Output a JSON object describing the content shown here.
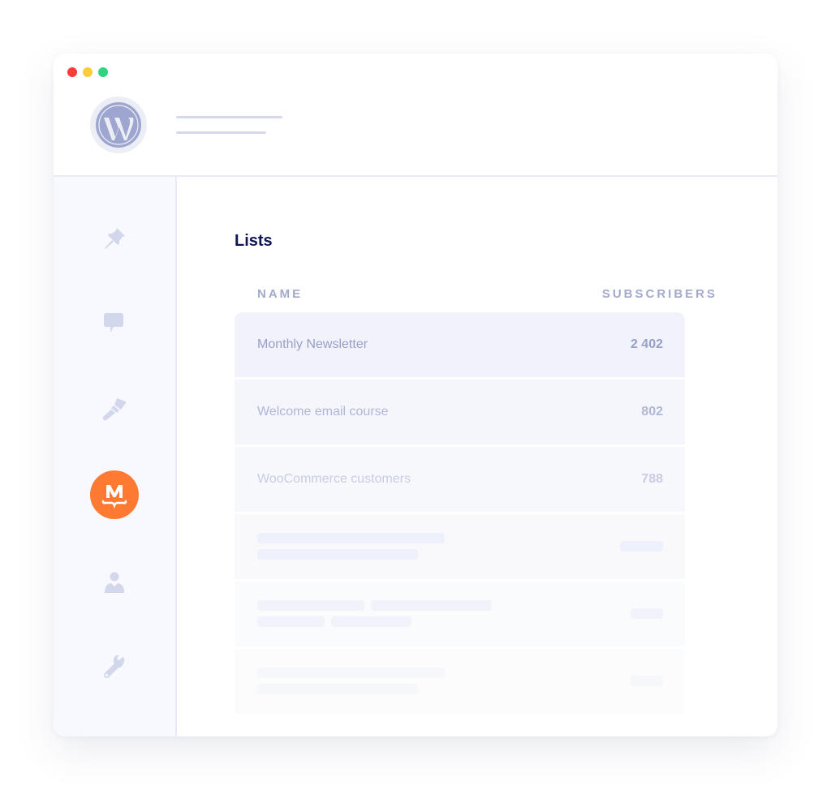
{
  "window": {
    "traffic_lights": [
      "close",
      "minimize",
      "maximize"
    ],
    "colors": {
      "close": "#fe3a3a",
      "minimize": "#fecb3a",
      "maximize": "#2ed47f"
    }
  },
  "header": {
    "logo": "wordpress-logo"
  },
  "sidebar": {
    "items": [
      {
        "icon": "pin-icon",
        "label": "Posts"
      },
      {
        "icon": "comment-icon",
        "label": "Comments"
      },
      {
        "icon": "paintbrush-icon",
        "label": "Appearance"
      },
      {
        "icon": "mailpoet-icon",
        "label": "MailPoet",
        "active": true,
        "color": "#fe7a33"
      },
      {
        "icon": "user-icon",
        "label": "Users"
      },
      {
        "icon": "wrench-icon",
        "label": "Tools"
      }
    ]
  },
  "main": {
    "title": "Lists",
    "columns": {
      "name": "NAME",
      "subscribers": "SUBSCRIBERS"
    },
    "rows": [
      {
        "name": "Monthly Newsletter",
        "subscribers": "2 402"
      },
      {
        "name": "Welcome email course",
        "subscribers": "802"
      },
      {
        "name": "WooCommerce customers",
        "subscribers": "788"
      }
    ],
    "placeholder_rows": 3
  }
}
